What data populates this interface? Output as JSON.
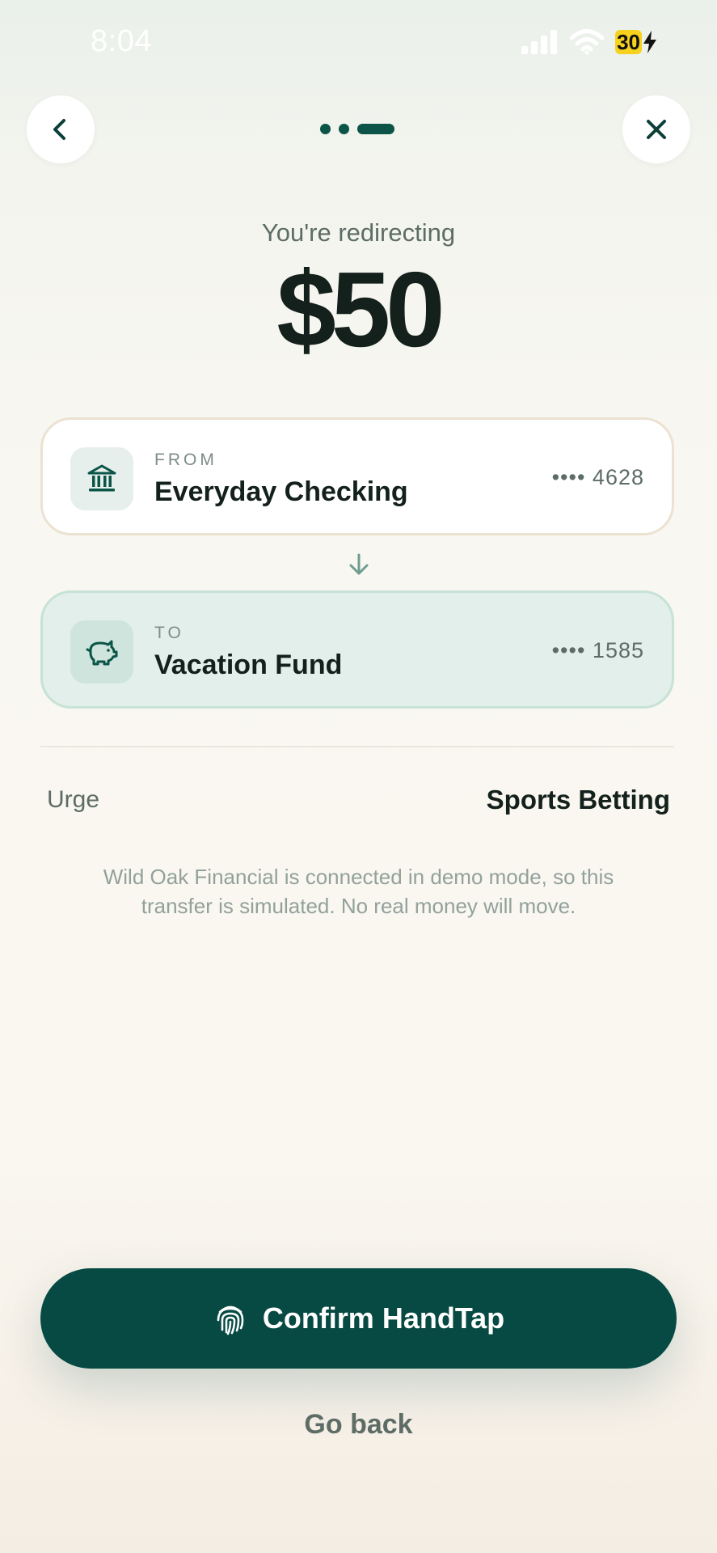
{
  "status_bar": {
    "time": "8:04",
    "battery_level": "30"
  },
  "navigation": {
    "back_icon": "chevron-left-icon",
    "close_icon": "close-icon",
    "stepper": {
      "total_steps": 3,
      "current_step": 3
    }
  },
  "header": {
    "subtitle": "You're redirecting",
    "amount": "$50"
  },
  "from_account": {
    "label": "FROM",
    "name": "Everyday Checking",
    "number": "•••• 4628",
    "icon": "bank-icon"
  },
  "to_account": {
    "label": "TO",
    "name": "Vacation Fund",
    "number": "•••• 1585",
    "icon": "piggy-bank-icon"
  },
  "urge": {
    "label": "Urge",
    "value": "Sports Betting"
  },
  "note": "Wild Oak Financial is connected in demo mode, so this transfer is simulated. No real money will move.",
  "actions": {
    "confirm_label": "Confirm HandTap",
    "confirm_icon": "fingerprint-icon",
    "go_back_label": "Go back"
  },
  "colors": {
    "primary": "#064a43",
    "accent": "#0b5447",
    "to_card_bg": "#e2efea",
    "battery": "#f6d21e"
  }
}
